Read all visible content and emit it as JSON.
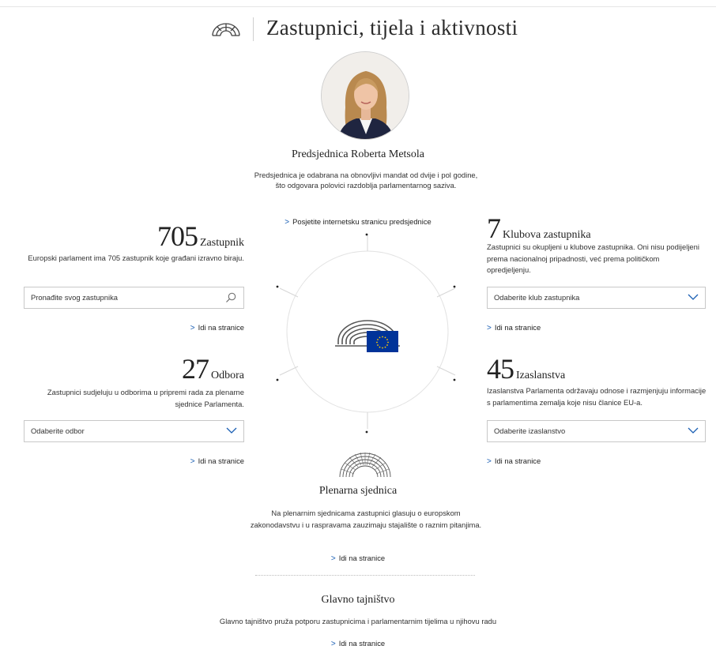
{
  "header": {
    "logo_icon": "hemicycle-logo-icon",
    "title": "Zastupnici, tijela i aktivnosti"
  },
  "president": {
    "name": "Predsjednica Roberta Metsola",
    "description": "Predsjednica je odabrana na obnovljivi mandat od dvije i pol godine, što odgovara polovici razdoblja parlamentarnog saziva.",
    "link": "Posjetite internetsku stranicu predsjednice"
  },
  "members": {
    "count": "705",
    "label": "Zastupnik",
    "description": "Europski parlament ima 705 zastupnik koje građani izravno biraju.",
    "search_placeholder": "Pronađite svog zastupnika",
    "link": "Idi na stranice"
  },
  "groups": {
    "count": "7",
    "label": "Klubova zastupnika",
    "description": "Zastupnici su okupljeni u klubove zastupnika. Oni nisu podijeljeni prema nacionalnoj pripadnosti, već prema političkom opredjeljenju.",
    "select_value": "Odaberite klub zastupnika",
    "link": "Idi na stranice"
  },
  "committees": {
    "count": "27",
    "label": "Odbora",
    "description": "Zastupnici sudjeluju u odborima u pripremi rada za plenarne sjednice Parlamenta.",
    "select_value": "Odaberite odbor",
    "link": "Idi na stranice"
  },
  "delegations": {
    "count": "45",
    "label": "Izaslanstva",
    "description": "Izaslanstva Parlamenta održavaju odnose i razmjenjuju informacije s parlamentima zemalja koje nisu članice EU-a.",
    "select_value": "Odaberite izaslanstvo",
    "link": "Idi na stranice"
  },
  "plenary": {
    "title": "Plenarna sjednica",
    "description": "Na plenarnim sjednicama zastupnici glasuju o europskom zakonodavstvu i u raspravama zauzimaju stajalište o raznim pitanjima.",
    "link": "Idi na stranice"
  },
  "secretariat": {
    "title": "Glavno tajništvo",
    "description": "Glavno tajništvo pruža potporu zastupnicima i parlamentarnim tijelima u njihovu radu",
    "link": "Idi na stranice"
  },
  "colors": {
    "accent_link": "#1a5fb4",
    "eu_blue": "#003399",
    "eu_gold": "#ffcc00"
  }
}
